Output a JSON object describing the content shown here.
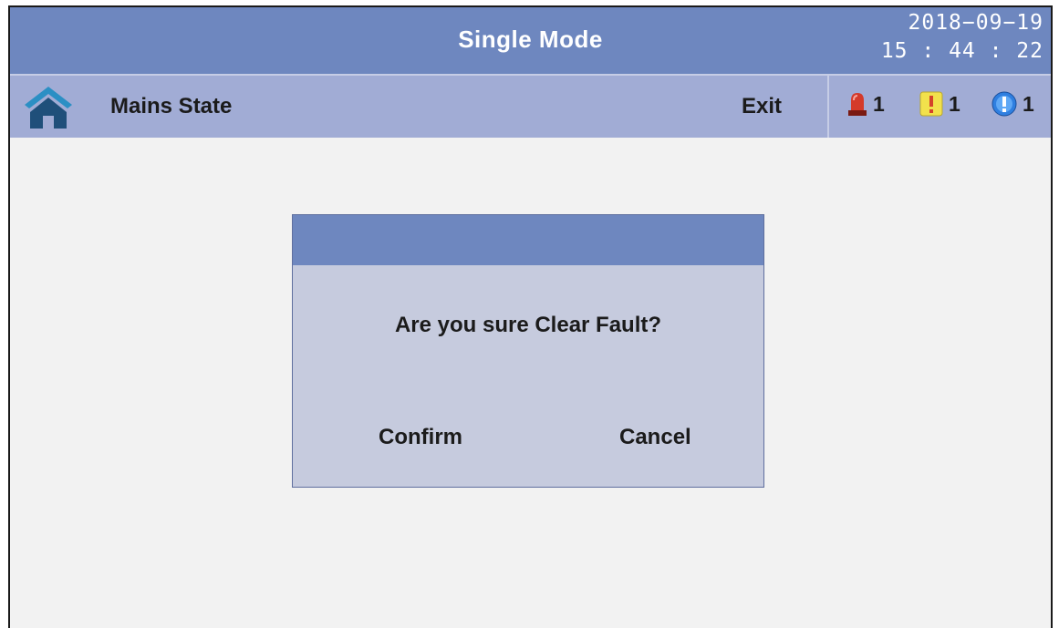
{
  "header": {
    "title": "Single Mode",
    "date": "2018−09−19",
    "time": "15 : 44 : 22"
  },
  "nav": {
    "home_icon": "home-icon",
    "title": "Mains State",
    "exit_label": "Exit"
  },
  "alarms": [
    {
      "icon": "siren-icon",
      "count": "1",
      "color": "#d43a2a"
    },
    {
      "icon": "warning-icon",
      "count": "1",
      "color": "#f2e14c"
    },
    {
      "icon": "info-icon",
      "count": "1",
      "color": "#2f7fe0"
    }
  ],
  "dialog": {
    "message": "Are you sure Clear Fault?",
    "confirm_label": "Confirm",
    "cancel_label": "Cancel"
  },
  "colors": {
    "title_bar": "#6e87bf",
    "nav_bar": "#a1acd5",
    "dialog_body": "#c6cbde",
    "background": "#f2f2f2"
  }
}
